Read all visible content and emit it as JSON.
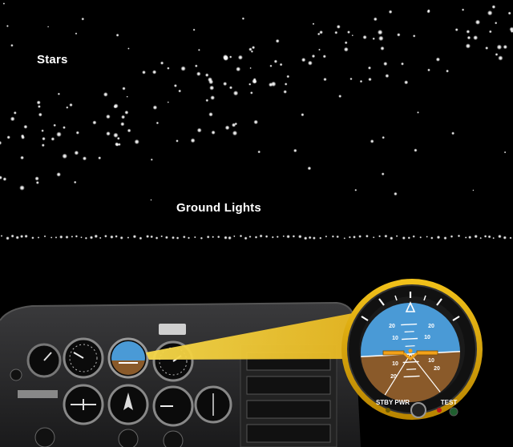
{
  "labels": {
    "stars": "Stars",
    "ground_lights": "Ground Lights"
  },
  "instrument": {
    "standby_button": "STBY PWR",
    "test_button": "TEST",
    "pitch_marks": [
      "20",
      "10",
      "10",
      "20",
      "10",
      "20",
      "20",
      "10"
    ]
  },
  "colors": {
    "sky": "#4a9ad6",
    "ground": "#8a5a2a",
    "bezel_gold": "#d9a400",
    "light_beam": "#f3cf3a",
    "star": "#ffffff"
  }
}
